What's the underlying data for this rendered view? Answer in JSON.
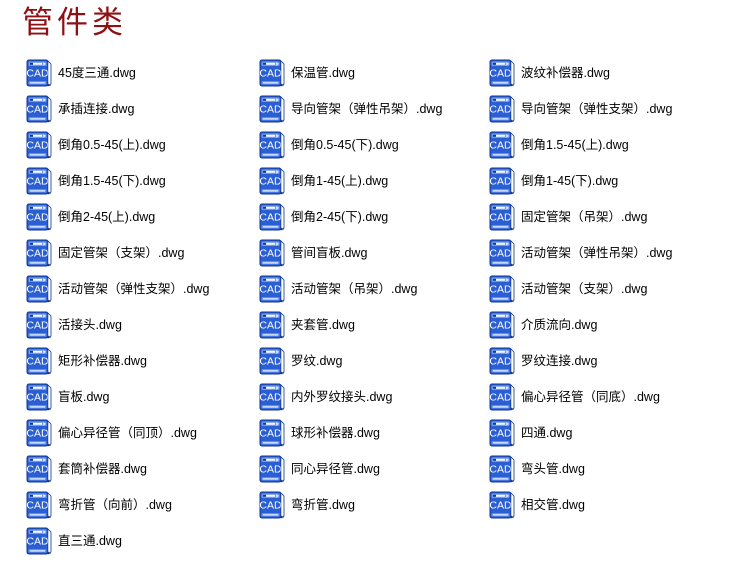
{
  "page": {
    "title": "管件类",
    "title_color": "#8d1014",
    "background_color": "#ffffff"
  },
  "icon": {
    "semantic_name": "cad-file-icon",
    "label_text": "CAD",
    "body_color": "#2a5fd4",
    "highlight_color": "#6f9bee",
    "edge_color": "#11348f",
    "text_color": "#ffffff"
  },
  "grid": {
    "columns": 3,
    "rows": [
      [
        {
          "name": "45度三通.dwg"
        },
        {
          "name": "保温管.dwg"
        },
        {
          "name": "波纹补偿器.dwg"
        }
      ],
      [
        {
          "name": "承插连接.dwg"
        },
        {
          "name": "导向管架（弹性吊架）.dwg"
        },
        {
          "name": "导向管架（弹性支架）.dwg"
        }
      ],
      [
        {
          "name": "倒角0.5-45(上).dwg"
        },
        {
          "name": "倒角0.5-45(下).dwg"
        },
        {
          "name": "倒角1.5-45(上).dwg"
        }
      ],
      [
        {
          "name": "倒角1.5-45(下).dwg"
        },
        {
          "name": "倒角1-45(上).dwg"
        },
        {
          "name": "倒角1-45(下).dwg"
        }
      ],
      [
        {
          "name": "倒角2-45(上).dwg"
        },
        {
          "name": "倒角2-45(下).dwg"
        },
        {
          "name": "固定管架（吊架）.dwg"
        }
      ],
      [
        {
          "name": "固定管架（支架）.dwg"
        },
        {
          "name": "管间盲板.dwg"
        },
        {
          "name": "活动管架（弹性吊架）.dwg"
        }
      ],
      [
        {
          "name": "活动管架（弹性支架）.dwg"
        },
        {
          "name": "活动管架（吊架）.dwg"
        },
        {
          "name": "活动管架（支架）.dwg"
        }
      ],
      [
        {
          "name": "活接头.dwg"
        },
        {
          "name": "夹套管.dwg"
        },
        {
          "name": "介质流向.dwg"
        }
      ],
      [
        {
          "name": "矩形补偿器.dwg"
        },
        {
          "name": "罗纹.dwg"
        },
        {
          "name": "罗纹连接.dwg"
        }
      ],
      [
        {
          "name": "盲板.dwg"
        },
        {
          "name": "内外罗纹接头.dwg"
        },
        {
          "name": "偏心异径管（同底）.dwg"
        }
      ],
      [
        {
          "name": "偏心异径管（同顶）.dwg"
        },
        {
          "name": "球形补偿器.dwg"
        },
        {
          "name": "四通.dwg"
        }
      ],
      [
        {
          "name": "套筒补偿器.dwg"
        },
        {
          "name": "同心异径管.dwg"
        },
        {
          "name": "弯头管.dwg"
        }
      ],
      [
        {
          "name": "弯折管（向前）.dwg"
        },
        {
          "name": "弯折管.dwg"
        },
        {
          "name": "相交管.dwg"
        }
      ],
      [
        {
          "name": "直三通.dwg"
        },
        {
          "name": ""
        },
        {
          "name": ""
        }
      ]
    ]
  }
}
